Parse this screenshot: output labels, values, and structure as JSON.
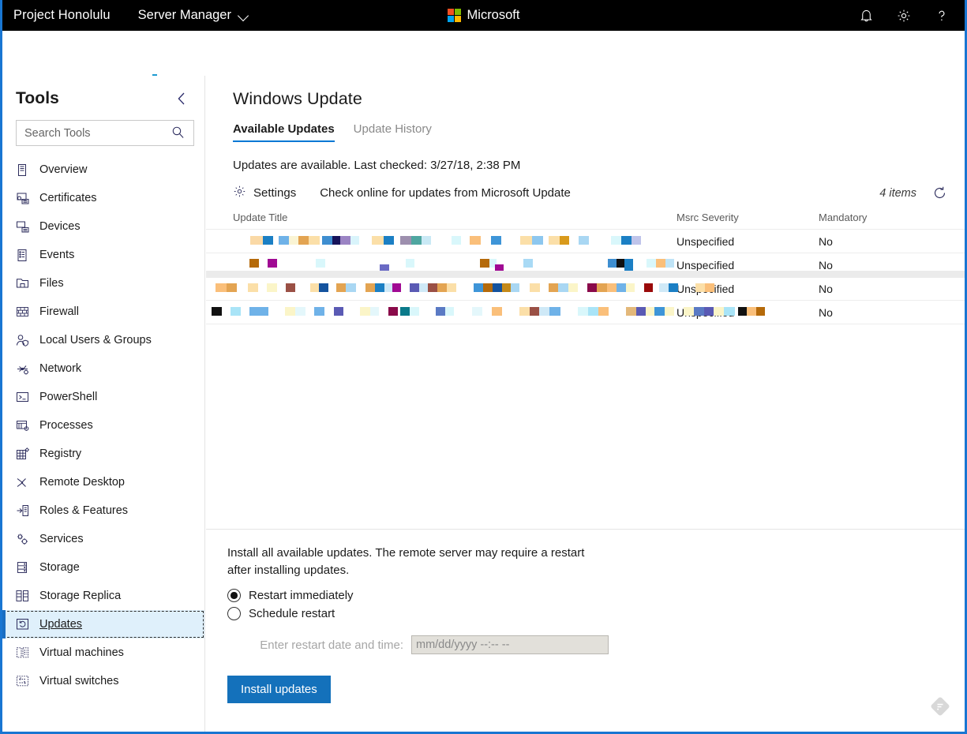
{
  "topbar": {
    "brand": "Project Honolulu",
    "app_name": "Server Manager",
    "app_chevron_icon": "chevron-down-icon",
    "ms_logo_word": "Microsoft",
    "ms_logo_colors": [
      "#f25022",
      "#7fba00",
      "#00a4ef",
      "#ffb900"
    ],
    "bell_icon": "bell-icon",
    "gear_icon": "gear-icon",
    "help_icon": "question-mark-icon",
    "background": "#000000"
  },
  "server_name": {
    "redacted": true,
    "label": ""
  },
  "sidebar": {
    "title": "Tools",
    "collapse_icon": "chevron-left-icon",
    "search": {
      "placeholder": "Search Tools",
      "value": "",
      "icon": "search-icon"
    },
    "items": [
      {
        "label": "Overview",
        "icon": "overview-icon",
        "selected": false
      },
      {
        "label": "Certificates",
        "icon": "certificate-icon",
        "selected": false
      },
      {
        "label": "Devices",
        "icon": "devices-icon",
        "selected": false
      },
      {
        "label": "Events",
        "icon": "events-icon",
        "selected": false
      },
      {
        "label": "Files",
        "icon": "folder-icon",
        "selected": false
      },
      {
        "label": "Firewall",
        "icon": "firewall-icon",
        "selected": false
      },
      {
        "label": "Local Users & Groups",
        "icon": "users-icon",
        "selected": false
      },
      {
        "label": "Network",
        "icon": "network-icon",
        "selected": false
      },
      {
        "label": "PowerShell",
        "icon": "console-icon",
        "selected": false
      },
      {
        "label": "Processes",
        "icon": "processes-icon",
        "selected": false
      },
      {
        "label": "Registry",
        "icon": "registry-grid-icon",
        "selected": false
      },
      {
        "label": "Remote Desktop",
        "icon": "remote-desktop-icon",
        "selected": false
      },
      {
        "label": "Roles & Features",
        "icon": "roles-features-icon",
        "selected": false
      },
      {
        "label": "Services",
        "icon": "services-gears-icon",
        "selected": false
      },
      {
        "label": "Storage",
        "icon": "storage-icon",
        "selected": false
      },
      {
        "label": "Storage Replica",
        "icon": "storage-replica-icon",
        "selected": false
      },
      {
        "label": "Updates",
        "icon": "updates-refresh-icon",
        "selected": true
      },
      {
        "label": "Virtual machines",
        "icon": "virtual-machines-icon",
        "selected": false
      },
      {
        "label": "Virtual switches",
        "icon": "virtual-switches-icon",
        "selected": false
      }
    ]
  },
  "main": {
    "page_title": "Windows Update",
    "tabs": [
      {
        "label": "Available Updates",
        "active": true
      },
      {
        "label": "Update History",
        "active": false
      }
    ],
    "status_line": "Updates are available. Last checked: 3/27/18, 2:38 PM",
    "commands": {
      "settings_label": "Settings",
      "settings_icon": "gear-icon",
      "check_online_label": "Check online for updates from Microsoft Update",
      "items_count": "4 items",
      "refresh_icon": "refresh-icon"
    },
    "table": {
      "columns": [
        "Update Title",
        "Msrc Severity",
        "Mandatory"
      ],
      "rows": [
        {
          "title": "",
          "title_redacted": true,
          "severity": "Unspecified",
          "mandatory": "No"
        },
        {
          "title": "",
          "title_redacted": true,
          "severity": "Unspecified",
          "mandatory": "No"
        },
        {
          "title": "",
          "title_redacted": true,
          "severity": "Unspecified",
          "mandatory": "No"
        },
        {
          "title": "",
          "title_redacted": true,
          "severity": "Unspecified",
          "mandatory": "No"
        }
      ]
    }
  },
  "bottom_panel": {
    "description": "Install all available updates. The remote server may require a restart after installing updates.",
    "radio_options": [
      {
        "label": "Restart immediately",
        "checked": true
      },
      {
        "label": "Schedule restart",
        "checked": false
      }
    ],
    "datetime": {
      "label": "Enter restart date and time:",
      "placeholder": "mm/dd/yyyy --:-- --",
      "value": "",
      "disabled": true
    },
    "install_button": "Install updates",
    "install_button_color": "#1471bb",
    "feedback_icon": "feedback-diamond-icon"
  },
  "window": {
    "border_color": "#1976d2"
  }
}
